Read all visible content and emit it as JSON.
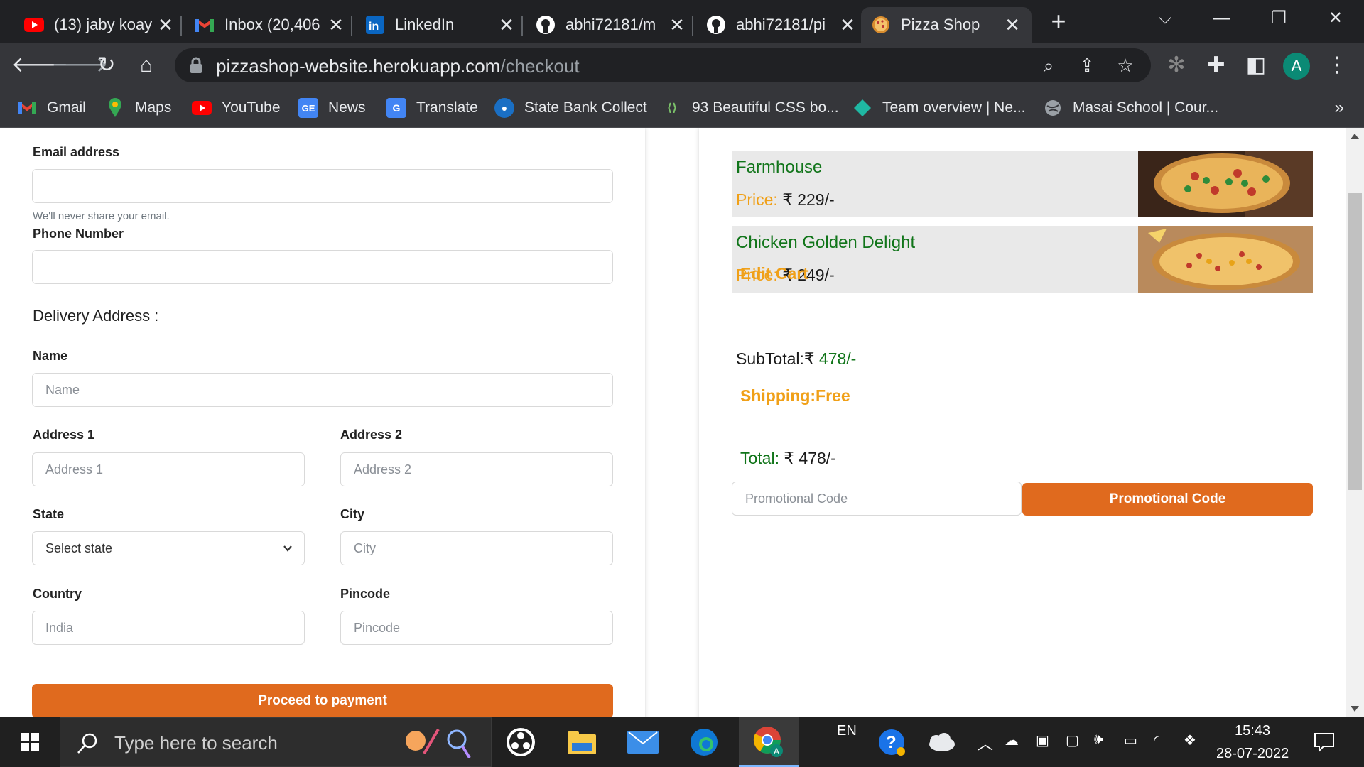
{
  "browser": {
    "tabs": [
      {
        "title": "(13) jaby koay",
        "icon": "youtube-icon"
      },
      {
        "title": "Inbox (20,406",
        "icon": "gmail-icon"
      },
      {
        "title": "LinkedIn",
        "icon": "linkedin-icon"
      },
      {
        "title": "abhi72181/m",
        "icon": "github-icon"
      },
      {
        "title": "abhi72181/pi",
        "icon": "github-icon"
      },
      {
        "title": "Pizza Shop",
        "icon": "pizza-icon",
        "active": true
      }
    ],
    "url_host": "pizzashop-website.herokuapp.com",
    "url_path": "/checkout",
    "profile_initial": "A",
    "bookmarks": [
      {
        "label": "Gmail",
        "icon": "gmail-icon"
      },
      {
        "label": "Maps",
        "icon": "maps-icon"
      },
      {
        "label": "YouTube",
        "icon": "youtube-icon"
      },
      {
        "label": "News",
        "icon": "news-icon"
      },
      {
        "label": "Translate",
        "icon": "translate-icon"
      },
      {
        "label": "State Bank Collect",
        "icon": "sbi-icon"
      },
      {
        "label": "93 Beautiful CSS bo...",
        "icon": "css-icon"
      },
      {
        "label": "Team overview | Ne...",
        "icon": "diamond-icon"
      },
      {
        "label": "Masai School | Cour...",
        "icon": "globe-icon"
      }
    ],
    "bookmarks_more": "»"
  },
  "form": {
    "email_label": "Email address",
    "email_value": "",
    "email_help": "We'll never share your email.",
    "phone_label": "Phone Number",
    "phone_value": "",
    "delivery_title": "Delivery Address :",
    "name_label": "Name",
    "name_placeholder": "Name",
    "address1_label": "Address 1",
    "address1_placeholder": "Address 1",
    "address2_label": "Address 2",
    "address2_placeholder": "Address 2",
    "state_label": "State",
    "state_selected": "Select state",
    "city_label": "City",
    "city_placeholder": "City",
    "country_label": "Country",
    "country_placeholder": "India",
    "pincode_label": "Pincode",
    "pincode_placeholder": "Pincode",
    "proceed_label": "Proceed to payment"
  },
  "cart": {
    "items": [
      {
        "name": "Farmhouse",
        "price_label": "Price:",
        "price": "₹ 229/-"
      },
      {
        "name": "Chicken Golden Delight",
        "price_label": "Price:",
        "price": "₹ 249/-"
      }
    ],
    "edit_cart_label": "Edit Cart",
    "subtotal_label": "SubTotal:₹",
    "subtotal_value": "478/-",
    "shipping_label": "Shipping:Free",
    "total_label": "Total:",
    "total_value": "₹ 478/-",
    "promo_placeholder": "Promotional Code",
    "promo_button_label": "Promotional Code"
  },
  "colors": {
    "accent_orange": "#e06a1e",
    "item_name_green": "#11751a",
    "price_label_orange": "#f0a018"
  },
  "taskbar": {
    "search_placeholder": "Type here to search",
    "language": "EN",
    "time": "15:43",
    "date": "28-07-2022"
  }
}
